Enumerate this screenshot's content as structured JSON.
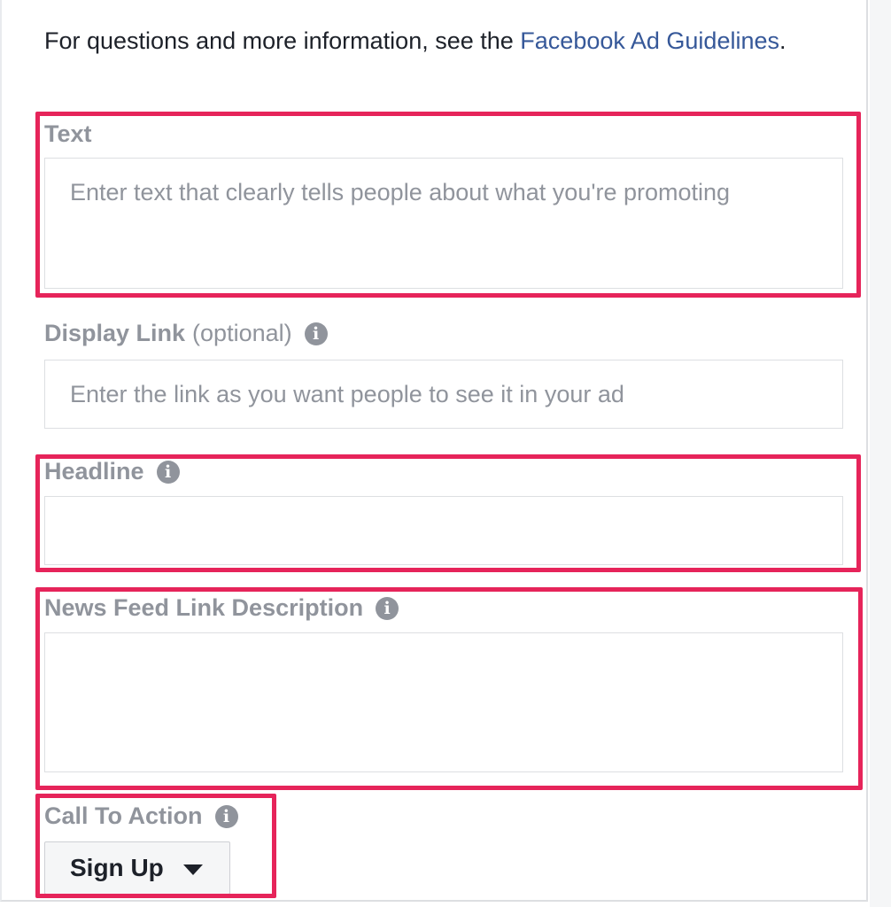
{
  "intro": {
    "text": "For questions and more information, see the ",
    "link": "Facebook Ad Guidelines",
    "end": "."
  },
  "fields": {
    "text": {
      "label": "Text",
      "placeholder": "Enter text that clearly tells people about what you're promoting"
    },
    "display_link": {
      "label": "Display Link",
      "optional": "(optional)",
      "placeholder": "Enter the link as you want people to see it in your ad"
    },
    "headline": {
      "label": "Headline",
      "placeholder": ""
    },
    "news_feed_description": {
      "label": "News Feed Link Description",
      "placeholder": ""
    }
  },
  "call_to_action": {
    "label": "Call To Action",
    "selected": "Sign Up"
  },
  "icons": {
    "info": "info-icon",
    "dropdown": "caret-down-icon"
  },
  "colors": {
    "highlight": "#e6245a",
    "link": "#365899",
    "label": "#90949c"
  }
}
